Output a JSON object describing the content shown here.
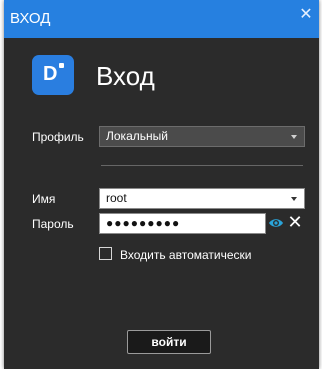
{
  "window": {
    "title": "ВХОД",
    "close_icon": "close-icon"
  },
  "header": {
    "logo_letter": "D",
    "heading": "Вход"
  },
  "form": {
    "profile_label": "Профиль",
    "profile_value": "Локальный",
    "username_label": "Имя",
    "username_value": "root",
    "password_label": "Пароль",
    "password_value": "●●●●●●●●●",
    "auto_login_label": "Входить автоматически",
    "auto_login_checked": false,
    "login_button": "войти"
  },
  "colors": {
    "titlebar": "#2680e0",
    "window_bg": "#2b2b2b",
    "logo": "#2a7ee0",
    "eye_icon": "#2aa3d8"
  }
}
